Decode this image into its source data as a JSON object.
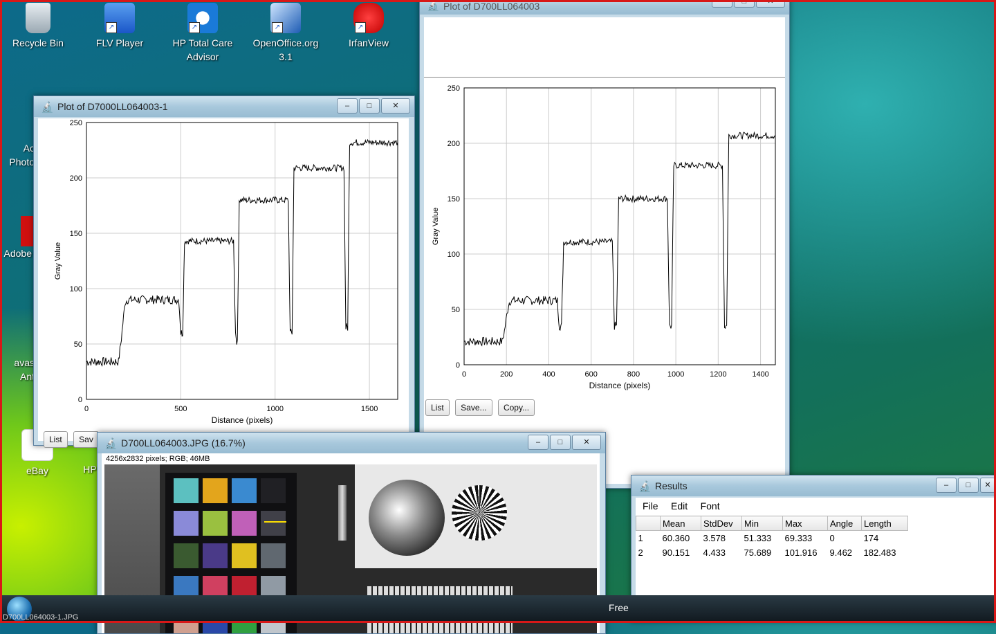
{
  "desktop": {
    "icons": [
      {
        "label": "Recycle Bin",
        "icon": "recycle-bin-icon"
      },
      {
        "label": "FLV Player",
        "icon": "flv-player-icon"
      },
      {
        "label": "HP Total Care Advisor",
        "icon": "hp-care-icon"
      },
      {
        "label": "OpenOffice.org 3.1",
        "icon": "openoffice-icon"
      },
      {
        "label": "IrfanView",
        "icon": "irfanview-icon"
      }
    ],
    "partial_labels": [
      "Ac",
      "Photo",
      "Adobe",
      "avas",
      "Ant",
      "eBay",
      "HP"
    ]
  },
  "plot1": {
    "title": "Plot of D7000LL064003-1",
    "buttons": [
      "List",
      "Sav"
    ],
    "chart_data": {
      "type": "line",
      "xlabel": "Distance (pixels)",
      "ylabel": "Gray Value",
      "xlim": [
        0,
        1650
      ],
      "ylim": [
        0,
        250
      ],
      "xticks": [
        "0",
        "500",
        "1000",
        "1500"
      ],
      "yticks": [
        "0",
        "50",
        "100",
        "150",
        "200",
        "250"
      ],
      "grid": true,
      "series": [
        {
          "x": [
            0,
            170,
            185,
            205,
            220,
            490,
            500,
            510,
            520,
            780,
            790,
            800,
            810,
            1070,
            1080,
            1090,
            1100,
            1365,
            1375,
            1385,
            1395,
            1650
          ],
          "values": [
            34,
            34,
            55,
            88,
            90,
            90,
            60,
            60,
            143,
            143,
            60,
            50,
            180,
            180,
            60,
            60,
            209,
            209,
            65,
            65,
            232,
            232
          ]
        }
      ]
    }
  },
  "plot2": {
    "title": "Plot of D700LL064003",
    "buttons": [
      "List",
      "Save...",
      "Copy..."
    ],
    "chart_data": {
      "type": "line",
      "xlabel": "Distance (pixels)",
      "ylabel": "Gray Value",
      "xlim": [
        0,
        1470
      ],
      "ylim": [
        0,
        250
      ],
      "xticks": [
        "0",
        "200",
        "400",
        "600",
        "800",
        "1000",
        "1200",
        "1400"
      ],
      "yticks": [
        "0",
        "50",
        "100",
        "150",
        "200",
        "250"
      ],
      "grid": true,
      "series": [
        {
          "x": [
            0,
            180,
            190,
            210,
            220,
            440,
            450,
            460,
            470,
            700,
            710,
            720,
            730,
            960,
            970,
            980,
            990,
            1220,
            1230,
            1240,
            1250,
            1470
          ],
          "values": [
            21,
            21,
            30,
            55,
            58,
            58,
            35,
            35,
            111,
            111,
            35,
            35,
            150,
            150,
            35,
            35,
            180,
            180,
            35,
            35,
            207,
            207
          ]
        }
      ]
    }
  },
  "image_window": {
    "title": "D700LL064003.JPG (16.7%)",
    "info": "4256x2832 pixels; RGB; 46MB",
    "swatches": [
      "#5cc0c0",
      "#e3a51c",
      "#3a8ad0",
      "#202024",
      "#8a8ad8",
      "#9ac040",
      "#c060b8",
      "#404048",
      "#3a5a30",
      "#4a3a88",
      "#e0c020",
      "#606870",
      "#3a78c0",
      "#d04060",
      "#c02030",
      "#909aa4",
      "#d0a090",
      "#2a48a8",
      "#30a040",
      "#c0c6cc"
    ]
  },
  "results": {
    "title": "Results",
    "menu": [
      "File",
      "Edit",
      "Font"
    ],
    "columns": [
      "",
      "Mean",
      "StdDev",
      "Min",
      "Max",
      "Angle",
      "Length"
    ],
    "rows": [
      [
        "1",
        "60.360",
        "3.578",
        "51.333",
        "69.333",
        "0",
        "174"
      ],
      [
        "2",
        "90.151",
        "4.433",
        "75.689",
        "101.916",
        "9.462",
        "182.483"
      ]
    ]
  },
  "taskbar": {
    "item": "D700LL064003-1.JPG",
    "free_label": "Free"
  }
}
